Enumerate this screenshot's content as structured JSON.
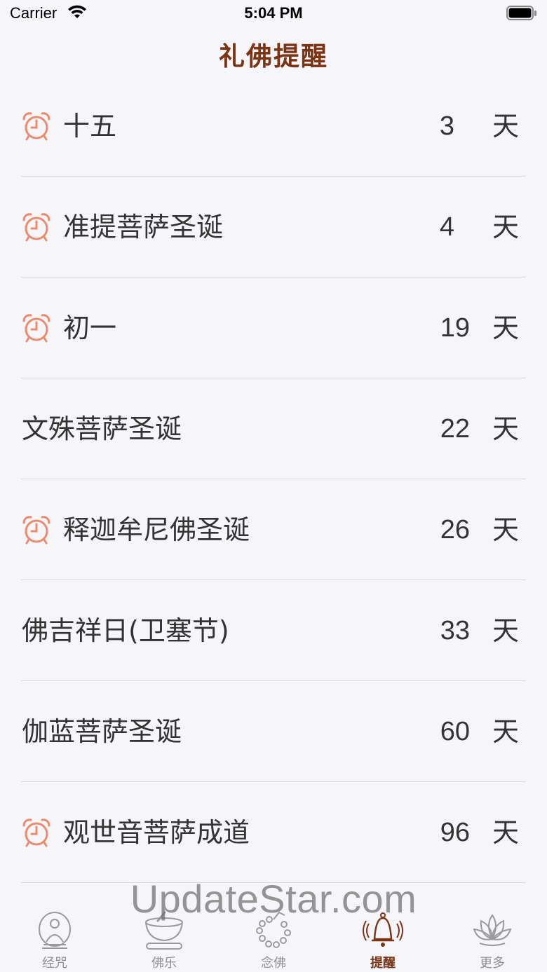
{
  "status_bar": {
    "carrier": "Carrier",
    "time": "5:04 PM"
  },
  "nav": {
    "title": "礼佛提醒"
  },
  "reminders": [
    {
      "name": "十五",
      "count": "3",
      "unit": "天",
      "alarm": true
    },
    {
      "name": "准提菩萨圣诞",
      "count": "4",
      "unit": "天",
      "alarm": true
    },
    {
      "name": "初一",
      "count": "19",
      "unit": "天",
      "alarm": true
    },
    {
      "name": "文殊菩萨圣诞",
      "count": "22",
      "unit": "天",
      "alarm": false
    },
    {
      "name": "释迦牟尼佛圣诞",
      "count": "26",
      "unit": "天",
      "alarm": true
    },
    {
      "name": "佛吉祥日(卫塞节)",
      "count": "33",
      "unit": "天",
      "alarm": false
    },
    {
      "name": "伽蓝菩萨圣诞",
      "count": "60",
      "unit": "天",
      "alarm": false
    },
    {
      "name": "观世音菩萨成道",
      "count": "96",
      "unit": "天",
      "alarm": true
    }
  ],
  "watermark": "UpdateStar.com",
  "tabs": [
    {
      "label": "经咒",
      "icon": "buddha-icon",
      "active": false
    },
    {
      "label": "佛乐",
      "icon": "singing-bowl-icon",
      "active": false
    },
    {
      "label": "念佛",
      "icon": "prayer-beads-icon",
      "active": false
    },
    {
      "label": "提醒",
      "icon": "bell-icon",
      "active": true
    },
    {
      "label": "更多",
      "icon": "lotus-icon",
      "active": false
    }
  ],
  "colors": {
    "accent": "#7b3515",
    "alarm": "#f08a6e",
    "inactive": "#8e8e93"
  }
}
